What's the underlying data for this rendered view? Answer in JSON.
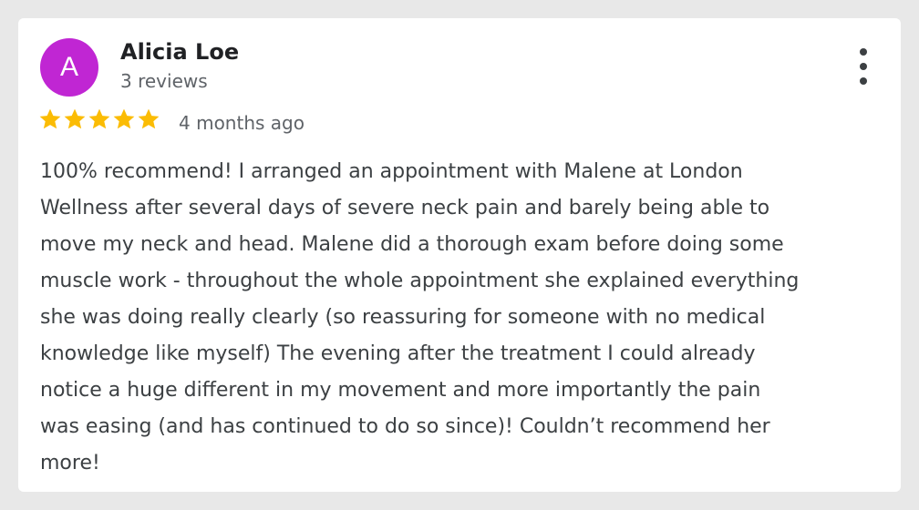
{
  "review": {
    "avatar_initial": "A",
    "avatar_color": "#c026d3",
    "author_name": "Alicia Loe",
    "review_count": "3 reviews",
    "rating": 5,
    "rating_max": 5,
    "star_color": "#fbbc04",
    "time_ago": "4 months ago",
    "menu_icon": "more-vertical-icon",
    "text_lines": [
      "100% recommend! I arranged an appointment with Malene at London",
      "Wellness after several days of severe neck pain and barely being able to",
      "move my neck and head. Malene did a thorough exam before doing some",
      "muscle work - throughout the whole appointment she explained everything",
      "she was doing really clearly (so reassuring for someone with no medical",
      "knowledge like myself) The evening after the treatment I could already",
      "notice a huge different in my movement and more importantly the pain",
      "was easing (and has continued to do so since)! Couldn’t recommend her",
      "more!"
    ]
  }
}
